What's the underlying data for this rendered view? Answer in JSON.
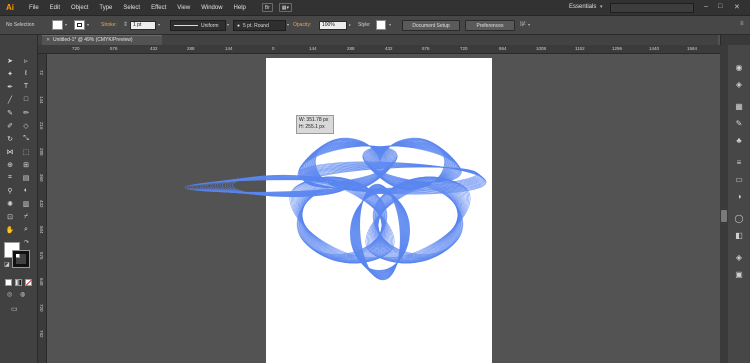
{
  "app": {
    "logo": "Ai"
  },
  "menu": {
    "items": [
      "File",
      "Edit",
      "Object",
      "Type",
      "Select",
      "Effect",
      "View",
      "Window",
      "Help"
    ]
  },
  "header": {
    "bridge": "Br",
    "arrange": "▦▾",
    "workspace": "Essentials",
    "workspace_chevron": "▾",
    "minimize": "–",
    "maximize": "□",
    "close": "✕"
  },
  "control_bar": {
    "selection_label": "No Selection",
    "stroke_label": "Stroke:",
    "stroke_weight": "1 pt",
    "stroke_style": "Uniform",
    "brush": "5 pt. Round",
    "opacity_label": "Opacity:",
    "opacity_value": "100%",
    "style_label": "Style:",
    "document_setup": "Document Setup",
    "preferences": "Preferences"
  },
  "document": {
    "tab_title": "Untitled-1* @ 49% (CMYK/Preview)",
    "close": "✕"
  },
  "ruler": {
    "h": [
      "720",
      "576",
      "432",
      "288",
      "144",
      "0",
      "144",
      "288",
      "432",
      "576",
      "720",
      "864",
      "1008",
      "1152",
      "1296",
      "1440",
      "1584"
    ],
    "v": [
      "72",
      "144",
      "216",
      "288",
      "360",
      "432",
      "504",
      "576",
      "648",
      "720",
      "792"
    ]
  },
  "tooltip": {
    "width": "W: 351.78 px",
    "height": "H: 255.1 px"
  },
  "colors": {
    "artwork_stroke": "#5a86f0",
    "accent": "#ff9a00",
    "link": "#f0a34a"
  },
  "icons": {
    "tools": [
      "selection-icon",
      "direct-selection-icon",
      "magic-wand-icon",
      "lasso-icon",
      "pen-icon",
      "type-icon",
      "line-icon",
      "rectangle-icon",
      "paintbrush-icon",
      "pencil-icon",
      "blob-brush-icon",
      "eraser-icon",
      "rotate-icon",
      "scale-icon",
      "width-icon",
      "free-transform-icon",
      "shape-builder-icon",
      "perspective-icon",
      "mesh-icon",
      "gradient-icon",
      "eyedropper-icon",
      "blend-icon",
      "symbol-sprayer-icon",
      "graph-icon",
      "artboard-icon",
      "slice-icon",
      "hand-icon",
      "zoom-icon"
    ],
    "dock": [
      "color-panel-icon",
      "color-guide-icon",
      "swatches-icon",
      "brushes-icon",
      "symbols-icon",
      "stroke-icon",
      "gradient-panel-icon",
      "transparency-icon",
      "appearance-icon",
      "graphic-styles-icon",
      "layers-icon",
      "artboards-icon"
    ]
  }
}
